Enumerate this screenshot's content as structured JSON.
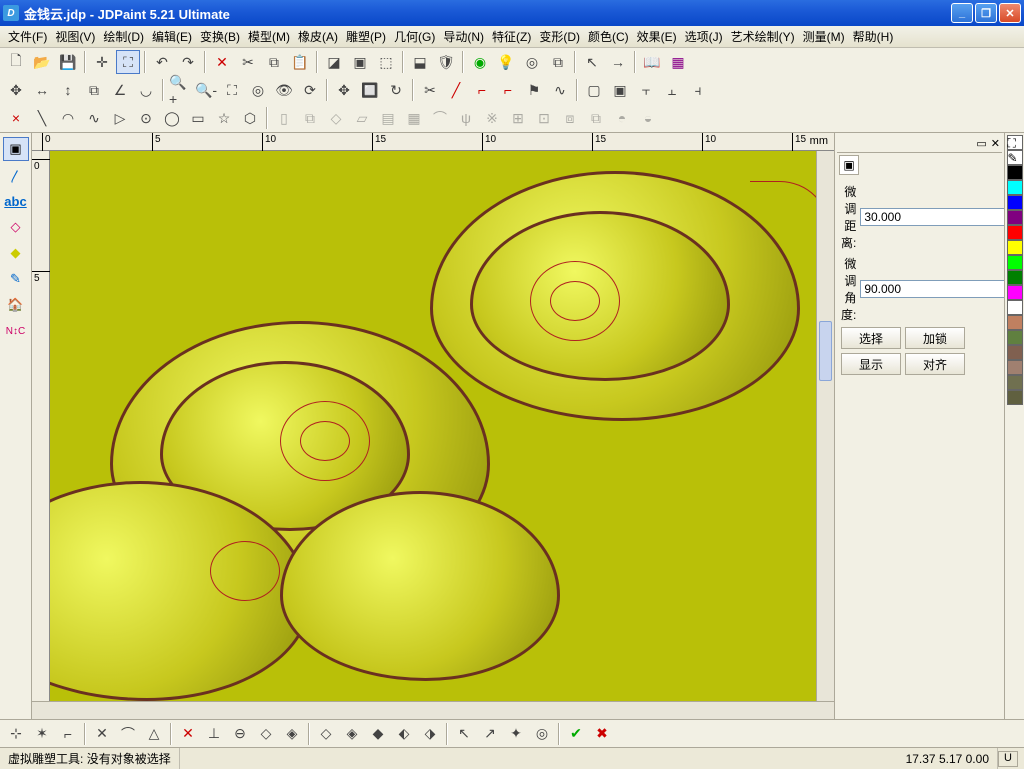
{
  "title": "金钱云.jdp - JDPaint 5.21 Ultimate",
  "menu": [
    "文件(F)",
    "视图(V)",
    "绘制(D)",
    "编辑(E)",
    "变换(B)",
    "模型(M)",
    "橡皮(A)",
    "雕塑(P)",
    "几何(G)",
    "导动(N)",
    "特征(Z)",
    "变形(D)",
    "颜色(C)",
    "效果(E)",
    "选项(J)",
    "艺术绘制(Y)",
    "测量(M)",
    "帮助(H)"
  ],
  "ruler_h": {
    "ticks": [
      "0",
      "5",
      "10",
      "15",
      "10",
      "15",
      "10",
      "15"
    ],
    "unit": "mm"
  },
  "ruler_v": {
    "ticks": [
      "0",
      "5"
    ]
  },
  "panel": {
    "dist_label": "微调距离:",
    "dist_val": "30.000",
    "angle_label": "微调角度:",
    "angle_val": "90.000",
    "btn_select": "选择",
    "btn_lock": "加锁",
    "btn_show": "显示",
    "btn_align": "对齐"
  },
  "status": {
    "tool": "虚拟雕塑工具:",
    "msg": "没有对象被选择",
    "coords": "17.37 5.17 0.00",
    "u": "U"
  },
  "palette": [
    "#000000",
    "#808080",
    "#ffffff",
    "#00ffff",
    "#0000ff",
    "#800080",
    "#ff0000",
    "#ffff00",
    "#00ff00",
    "#008000",
    "#ff00ff",
    "#ffffff",
    "#c08060",
    "#608040",
    "#806050",
    "#a08070",
    "#707050",
    "#606040"
  ]
}
